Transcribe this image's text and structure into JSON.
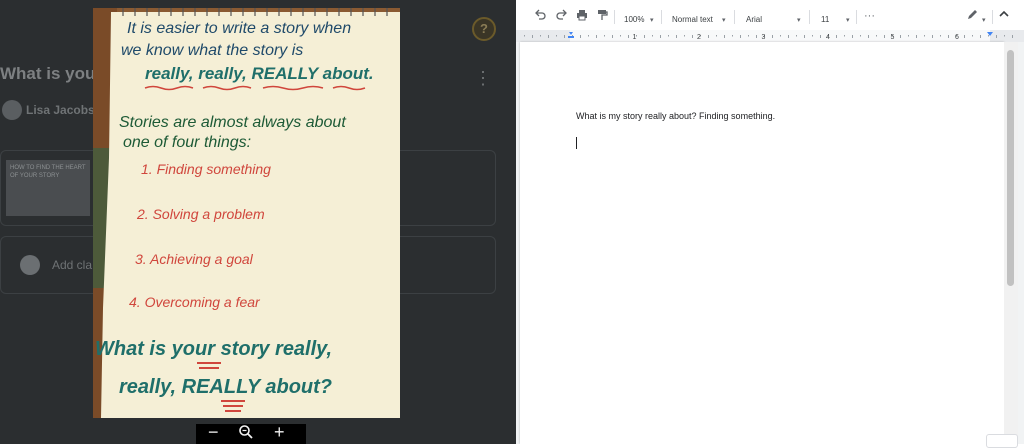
{
  "background_page": {
    "title": "What is your",
    "author": "Lisa Jacobs",
    "attachment_text": "HOW TO FIND THE HEART OF YOUR STORY",
    "comment_placeholder": "Add cla",
    "help_glyph": "?",
    "kebab_glyph": "⋮"
  },
  "lightbox": {
    "poster": {
      "intro_line_1": "It is easier to write a story when",
      "intro_line_2": "we know what the story is",
      "intro_line_3": "really, really, REALLY about.",
      "heading_line_1": "Stories are almost always about",
      "heading_line_2": "one of four things:",
      "items": [
        "1. Finding something",
        "2. Solving a problem",
        "3. Achieving a goal",
        "4. Overcoming a fear"
      ],
      "question_line_1": "What is your story really,",
      "question_line_2": "really, REALLY about?"
    },
    "zoom": {
      "zoom_out": "−",
      "zoom_in": "+",
      "magnifier_icon": "magnifier-icon"
    }
  },
  "docs": {
    "toolbar": {
      "zoom": "100%",
      "style": "Normal text",
      "font": "Arial",
      "size": "11",
      "more": "···",
      "collapse": "^"
    },
    "ruler_numbers": [
      "1",
      "2",
      "3",
      "4",
      "5",
      "6"
    ],
    "document_text": "What is my story really about? Finding something."
  },
  "colors": {
    "teal": "#1f6f6a",
    "red": "#d0463c",
    "dark_green": "#1d5a36",
    "poster_paper": "#f5efd6"
  }
}
